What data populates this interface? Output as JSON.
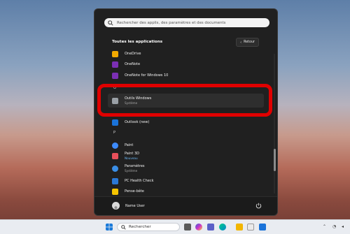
{
  "search": {
    "placeholder": "Rechercher des applis, des paramètres et des documents"
  },
  "header": {
    "title": "Toutes les applications",
    "back_label": "Retour"
  },
  "apps": [
    {
      "name": "OneDrive",
      "sub": "",
      "icon": "onedrive-icon",
      "color": "#f2a900"
    },
    {
      "name": "OneNote",
      "sub": "",
      "icon": "onenote-icon",
      "color": "#7b2fb4"
    },
    {
      "name": "OneNote for Windows 10",
      "sub": "",
      "icon": "onenote-icon",
      "color": "#7b2fb4"
    },
    {
      "name": "Outils Windows",
      "sub": "Système",
      "icon": "windows-tools-icon",
      "color": "#9aa0a6"
    },
    {
      "name": "Outlook (new)",
      "sub": "",
      "icon": "outlook-icon",
      "color": "#1a73d9"
    },
    {
      "name": "Paint",
      "sub": "",
      "icon": "paint-icon",
      "color": "#3d8bfd"
    },
    {
      "name": "Paint 3D",
      "sub": "Nouveau",
      "icon": "paint-3d-icon",
      "color": "#e8505b"
    },
    {
      "name": "Paramètres",
      "sub": "Système",
      "icon": "settings-icon",
      "color": "#3a8ee6"
    },
    {
      "name": "PC Health Check",
      "sub": "",
      "icon": "pc-health-check-icon",
      "color": "#2b78d6"
    },
    {
      "name": "Pense-bête",
      "sub": "",
      "icon": "sticky-notes-icon",
      "color": "#f5c400"
    }
  ],
  "letters": {
    "o": "O",
    "p": "P"
  },
  "user": {
    "name": "Name User"
  },
  "taskbar": {
    "search_placeholder": "Rechercher"
  },
  "colors": {
    "highlight": "#e00000",
    "menu_bg": "#202020"
  }
}
